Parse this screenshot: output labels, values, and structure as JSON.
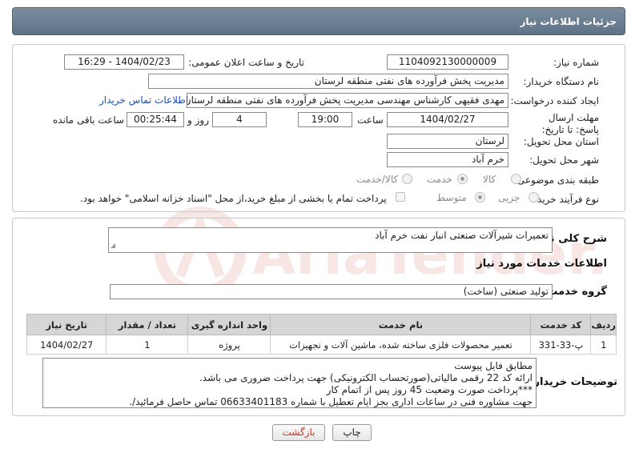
{
  "header": {
    "title": "جزئیات اطلاعات نیاز"
  },
  "labels": {
    "need_number": "شماره نیاز:",
    "public_date": "تاریخ و ساعت اعلان عمومی:",
    "buyer_org": "نام دستگاه خریدار:",
    "requester": "ایجاد کننده درخواست:",
    "deadline": "مهلت ارسال پاسخ: تا تاریخ:",
    "time_word": "ساعت",
    "days_word": "روز و",
    "remaining_word": "ساعت باقی مانده",
    "province": "استان محل تحویل:",
    "city": "شهر محل تحویل:",
    "category": "طبقه بندی موضوعی:",
    "process_type": "نوع فرآیند خرید :",
    "summary": "شرح کلی نیاز:",
    "services_info": "اطلاعات خدمات مورد نیاز",
    "service_group": "گروه خدمت:",
    "buyer_notes": "توضیحات خریدار:"
  },
  "fields": {
    "need_number": "1104092130000009",
    "public_date": "1404/02/23 - 16:29",
    "buyer_org": "مدیریت پخش فرآورده های نفتی منطقه لرستان",
    "requester": "مهدی فقیهی کارشناس مهندسی مدیریت پخش فرآورده های نفتی منطقه لرستان",
    "contact_link": "اطلاعات تماس خریدار",
    "deadline_date": "1404/02/27",
    "deadline_time": "19:00",
    "days": "4",
    "remaining": "00:25:44",
    "province": "لرستان",
    "city": "خرم آباد",
    "summary": "تعمیرات شیرآلات صنعتی انبار نفت خرم آباد",
    "service_group": "تولید صنعتی (ساخت)"
  },
  "category_options": [
    "کالا",
    "خدمت",
    "کالا/خدمت"
  ],
  "category_selected": "خدمت",
  "process_options": [
    "جزیی",
    "متوسط"
  ],
  "process_selected": "متوسط",
  "payment_note": "پرداخت تمام یا بخشی از مبلغ خرید،از محل \"اسناد خزانه اسلامی\" خواهد بود.",
  "table": {
    "headers": [
      "ردیف",
      "کد خدمت",
      "نام خدمت",
      "واحد اندازه گیری",
      "تعداد / مقدار",
      "تاریخ نیاز"
    ],
    "rows": [
      [
        "1",
        "پ-33-331",
        "تعمیر محصولات فلزی ساخته شده، ماشین آلات و تجهیزات",
        "پروژه",
        "1",
        "1404/02/27"
      ]
    ]
  },
  "notes": [
    "مطابق فایل پیوست",
    "ارائه کد 22 رقمی مالیاتی(صورتحساب الکترونیکی) جهت پرداخت ضروری می باشد.",
    "***پرداخت صورت وضعیت 45 روز پس از اتمام کار",
    "جهت مشاوره فنی در ساعات اداری بجز ایام تعطیل با شماره 06633401183 تماس حاصل فرمائید/."
  ],
  "buttons": {
    "print": "چاپ",
    "back": "بازگشت"
  },
  "watermark": "AriaTender.neT",
  "colors": {
    "header_bg": "#6b7f93",
    "link": "#1a4fb5",
    "back_text": "#c0392b",
    "watermark": "#c0392b"
  }
}
